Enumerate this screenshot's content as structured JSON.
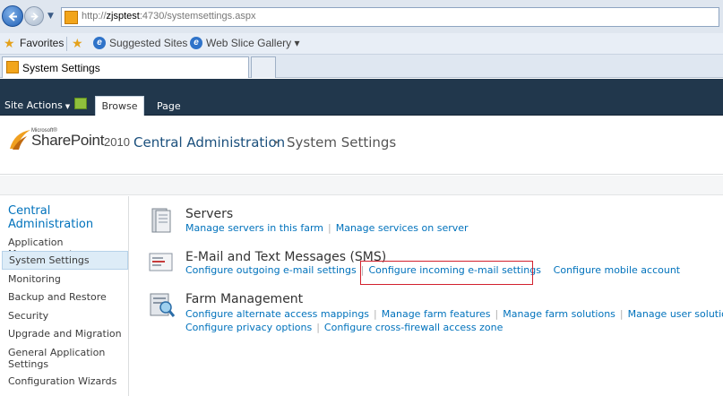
{
  "browser": {
    "url_prefix": "http://",
    "url_host": "zjsptest",
    "url_rest": ":4730/systemsettings.aspx",
    "favorites_label": "Favorites",
    "suggested_sites": "Suggested Sites ▾",
    "web_slice_gallery": "Web Slice Gallery ▾",
    "tab_title": "System Settings"
  },
  "ribbon": {
    "site_actions": "Site Actions",
    "tabs": [
      "Browse",
      "Page"
    ]
  },
  "header": {
    "logo_microsoft": "Microsoft®",
    "logo_product": "SharePoint",
    "logo_year": "2010",
    "breadcrumb_root": "Central Administration",
    "breadcrumb_sep": "▸",
    "breadcrumb_page": "System Settings"
  },
  "quick_launch": {
    "heading": "Central Administration",
    "items": [
      "Application Management",
      "System Settings",
      "Monitoring",
      "Backup and Restore",
      "Security",
      "Upgrade and Migration",
      "General Application Settings",
      "Configuration Wizards"
    ]
  },
  "sections": [
    {
      "title": "Servers",
      "links": [
        [
          "Manage servers in this farm",
          "Manage services on server"
        ]
      ]
    },
    {
      "title": "E-Mail and Text Messages (SMS)",
      "links": [
        [
          "Configure outgoing e-mail settings",
          "Configure incoming e-mail settings",
          "Configure mobile account"
        ]
      ]
    },
    {
      "title": "Farm Management",
      "links": [
        [
          "Configure alternate access mappings",
          "Manage farm features",
          "Manage farm solutions",
          "Manage user solutions"
        ],
        [
          "Configure privacy options",
          "Configure cross-firewall access zone"
        ]
      ]
    }
  ],
  "colors": {
    "ribbon_bg": "#21374c",
    "link": "#0072bc",
    "highlight_box": "#d2212e",
    "selected_nav_bg": "#ddecf7"
  }
}
